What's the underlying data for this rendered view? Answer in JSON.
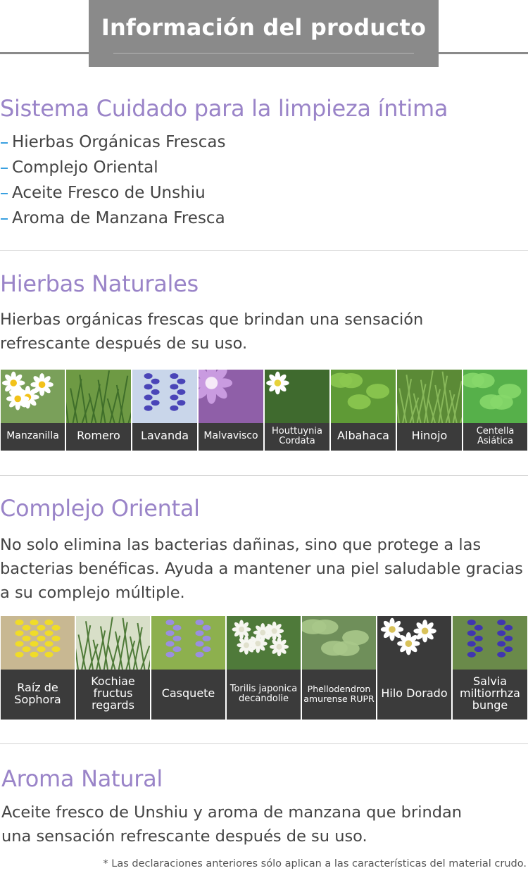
{
  "header": {
    "title": "Información del producto"
  },
  "sections": {
    "system": {
      "title": "Sistema Cuidado para la limpieza íntima",
      "bullets": [
        "Hierbas Orgánicas Frescas",
        "Complejo Oriental",
        "Aceite Fresco de Unshiu",
        "Aroma de Manzana Fresca"
      ]
    },
    "herbs": {
      "title": "Hierbas Naturales",
      "desc": "Hierbas orgánicas frescas que brindan una sensación refrescante después de su uso.",
      "items": [
        {
          "label": "Manzanilla",
          "icon": "chamomile-flower"
        },
        {
          "label": "Romero",
          "icon": "rosemary-plant"
        },
        {
          "label": "Lavanda",
          "icon": "lavender-flower"
        },
        {
          "label": "Malvavisco",
          "icon": "mallow-flower"
        },
        {
          "label": "Houttuynia Cordata",
          "icon": "houttuynia-flower"
        },
        {
          "label": "Albahaca",
          "icon": "basil-leaves"
        },
        {
          "label": "Hinojo",
          "icon": "fennel-plant"
        },
        {
          "label": "Centella Asiática",
          "icon": "centella-leaves"
        }
      ]
    },
    "oriental": {
      "title": "Complejo Oriental",
      "desc": "No solo elimina las bacterias dañinas, sino que protege a las bacterias benéficas. Ayuda a mantener una piel saludable gracias a su complejo múltiple.",
      "items": [
        {
          "label": "Raíz de Sophora",
          "icon": "sophora-flower"
        },
        {
          "label": "Kochiae fructus regards",
          "icon": "kochia-plant"
        },
        {
          "label": "Casquete",
          "icon": "skullcap-flower"
        },
        {
          "label": "Torilis japonica decandolie",
          "icon": "torilis-flower"
        },
        {
          "label": "Phellodendron amurense RUPR",
          "icon": "phellodendron-branch"
        },
        {
          "label": "Hilo Dorado",
          "icon": "golden-thread-flower"
        },
        {
          "label": "Salvia miltiorrhza bunge",
          "icon": "salvia-flower"
        }
      ]
    },
    "aroma": {
      "title": "Aroma Natural",
      "desc": "Aceite fresco de Unshiu y aroma de manzana que brindan una sensación refrescante después de su uso."
    }
  },
  "footnote": "* Las declaraciones anteriores sólo aplican a las características del material crudo.",
  "colors": {
    "accent": "#9a84c8",
    "header_bg": "#8a8a8a",
    "caption_bg": "#3b3b3b",
    "bullet_dash": "#3aa0e0"
  }
}
